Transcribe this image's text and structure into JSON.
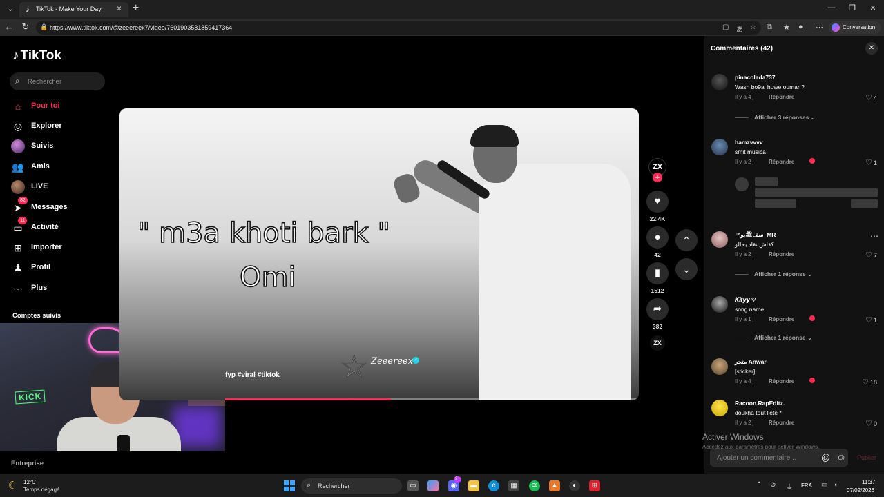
{
  "browser": {
    "tab_title": "TikTok - Make Your Day",
    "url": "https://www.tiktok.com/@zeeereex7/video/7601903581859417364",
    "conversation_label": "Conversation"
  },
  "sidebar": {
    "logo": "TikTok",
    "search_placeholder": "Rechercher",
    "items": [
      {
        "label": "Pour toi",
        "icon": "home-icon",
        "active": true
      },
      {
        "label": "Explorer",
        "icon": "compass-icon"
      },
      {
        "label": "Suivis",
        "icon": "avatar-icon"
      },
      {
        "label": "Amis",
        "icon": "friends-icon"
      },
      {
        "label": "LIVE",
        "icon": "avatar-icon"
      },
      {
        "label": "Messages",
        "icon": "send-icon",
        "badge": "82"
      },
      {
        "label": "Activité",
        "icon": "inbox-icon",
        "badge": "11"
      },
      {
        "label": "Importer",
        "icon": "plus-square-icon"
      },
      {
        "label": "Profil",
        "icon": "profile-icon"
      },
      {
        "label": "Plus",
        "icon": "more-icon"
      }
    ],
    "followed_title": "Comptes suivis",
    "footer": "Entreprise"
  },
  "video": {
    "title_text": "\" m3a khoti bark \"",
    "artist_text": "Omi",
    "caption": "fyp #viral #tiktok",
    "watermark": "Zeeereex",
    "progress": 0.4
  },
  "actions": {
    "creator_initials": "ZX",
    "likes": "22.4K",
    "comments": "42",
    "saves": "1512",
    "shares": "382"
  },
  "comments": {
    "header": "Commentaires (42)",
    "list": [
      {
        "user": "pinacolada737",
        "text": "Wash bo9al huwe oumar ?",
        "time": "Il y a 4 j",
        "reply": "Répondre",
        "likes": "4",
        "more": "Afficher 3 réponses"
      },
      {
        "user": "hamzvvvv",
        "text": "smit musica",
        "time": "Il y a 2 j",
        "reply": "Répondre",
        "likes": "1"
      },
      {
        "user": "™سفﷺبو_MR",
        "text": "كفاش نقاد بحالو",
        "time": "Il y a 2 j",
        "reply": "Répondre",
        "likes": "7",
        "more": "Afficher 1 réponse"
      },
      {
        "user": "𝑲𝒊𝒕𝒚𝒚 ♡",
        "text": "song name",
        "time": "Il y a 1 j",
        "reply": "Répondre",
        "likes": "1",
        "more": "Afficher 1 réponse"
      },
      {
        "user": "متجر Anwar",
        "text": "[sticker]",
        "time": "Il y a 4 j",
        "reply": "Répondre",
        "likes": "18"
      },
      {
        "user": "Racoon.RapEditz.",
        "text": "doukha tout l'été *",
        "time": "Il y a 2 j",
        "reply": "Répondre",
        "likes": "0"
      }
    ],
    "input_placeholder": "Ajouter un commentaire...",
    "post_label": "Publier"
  },
  "watermark_windows": {
    "title": "Activer Windows",
    "subtitle": "Accédez aux paramètres pour activer Windows."
  },
  "taskbar": {
    "temperature": "12°C",
    "weather": "Temps dégagé",
    "search_label": "Rechercher",
    "language": "FRA",
    "time": "11:37",
    "date": "07/02/2026",
    "discord_badge": "9+"
  },
  "colors": {
    "accent": "#fe2c55",
    "background": "#000000",
    "panel": "#121212"
  }
}
